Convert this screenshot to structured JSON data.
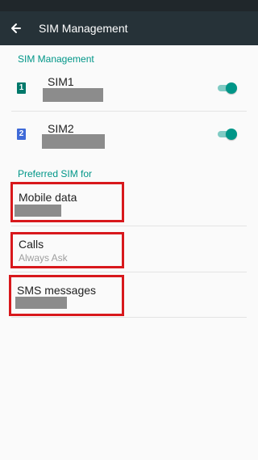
{
  "appbar": {
    "title": "SIM Management"
  },
  "sections": {
    "sims": "SIM Management",
    "preferred": "Preferred SIM for"
  },
  "sims": [
    {
      "icon_number": "1",
      "name": "SIM1",
      "enabled": true,
      "icon_color": "#00796b"
    },
    {
      "icon_number": "2",
      "name": "SIM2",
      "enabled": true,
      "icon_color": "#3f6ad8"
    }
  ],
  "preferred": {
    "mobile_data": {
      "label": "Mobile data"
    },
    "calls": {
      "label": "Calls",
      "value": "Always Ask"
    },
    "sms": {
      "label": "SMS messages"
    }
  },
  "colors": {
    "accent": "#009688",
    "appbar": "#263238",
    "highlight": "#d8181c"
  }
}
